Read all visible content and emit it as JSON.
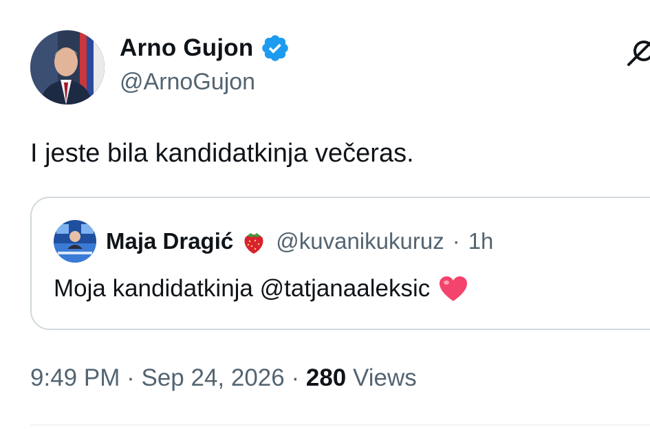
{
  "author": {
    "display_name": "Arno Gujon",
    "handle": "@ArnoGujon",
    "verified": true,
    "avatar_icon": "profile-photo-avatar"
  },
  "tweet": {
    "text": "I jeste bila kandidatkinja večeras."
  },
  "quoted_tweet": {
    "display_name": "Maja Dragić",
    "name_emoji": "strawberry-icon",
    "handle": "@kuvanikukuruz",
    "separator": "·",
    "time": "1h",
    "text": "Moja kandidatkinja @tatjanaaleksic",
    "text_emoji": "heart-icon",
    "avatar_icon": "tv-studio-avatar"
  },
  "meta": {
    "time": "9:49 PM",
    "separator1": "·",
    "date": "Sep 24, 2026",
    "separator2": "·",
    "views_count": "280",
    "views_label": "Views"
  },
  "colors": {
    "text": "#0f1419",
    "secondary_text": "#536471",
    "verified": "#1d9bf0",
    "border": "#cfd9de",
    "heart": "#f4436c"
  }
}
